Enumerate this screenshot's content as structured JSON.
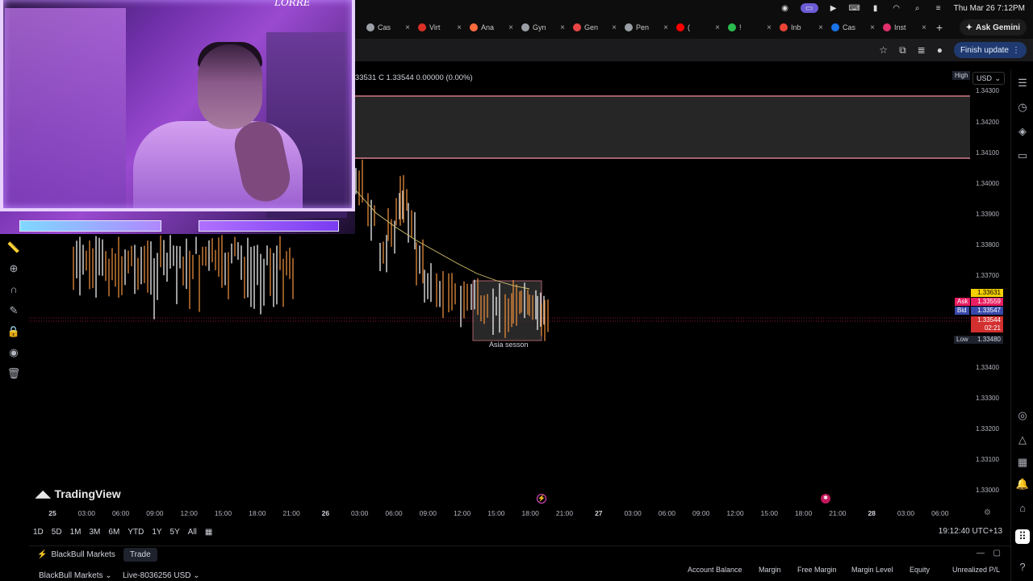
{
  "menubar": {
    "datetime": "Thu Mar 26  7:12PM",
    "icons": [
      "record-icon",
      "screen-share-icon",
      "play-icon",
      "keyboard-icon",
      "battery-icon",
      "wifi-icon",
      "search-icon",
      "control-center-icon"
    ]
  },
  "browser": {
    "tabs": [
      {
        "label": "Cas",
        "color": "#9aa0a6"
      },
      {
        "label": "Virt",
        "color": "#d93025"
      },
      {
        "label": "Ana",
        "color": "#ff6b3d"
      },
      {
        "label": "Gyn",
        "color": "#9aa0a6"
      },
      {
        "label": "Gen",
        "color": "#e84545"
      },
      {
        "label": "Pen",
        "color": "#9aa0a6"
      },
      {
        "label": "(",
        "color": "#ff0000"
      },
      {
        "label": "!",
        "color": "#2bbd4f"
      },
      {
        "label": "Inb",
        "color": "#ea4335"
      },
      {
        "label": "Cas",
        "color": "#1a73e8"
      },
      {
        "label": "Inst",
        "color": "#e1306c"
      }
    ],
    "ask_gemini": "Ask Gemini",
    "finish_update": "Finish update"
  },
  "chart": {
    "ohlc": "1.33531  C 1.33544  0.00000 (0.00%)",
    "currency": "USD",
    "high_label": "High",
    "low_label": "Low",
    "low_value": "1.33480",
    "price_ticks": [
      "1.34300",
      "1.34200",
      "1.34100",
      "1.34000",
      "1.33900",
      "1.33800",
      "1.33700",
      "1.33400",
      "1.33300",
      "1.33200",
      "1.33100",
      "1.33000"
    ],
    "price_badges": {
      "current": "1.33631",
      "ask_label": "Ask",
      "ask": "1.33559",
      "bid_label": "Bid",
      "bid": "1.33547",
      "last": "1.33544",
      "countdown": "02:21"
    },
    "time_labels": [
      "25",
      "03:00",
      "06:00",
      "09:00",
      "12:00",
      "15:00",
      "18:00",
      "21:00",
      "26",
      "03:00",
      "06:00",
      "09:00",
      "12:00",
      "15:00",
      "18:00",
      "21:00",
      "27",
      "03:00",
      "06:00",
      "09:00",
      "12:00",
      "15:00",
      "18:00",
      "21:00",
      "28",
      "03:00",
      "06:00"
    ],
    "session_label": "Asia sesson",
    "watermark": "TradingView"
  },
  "range_bar": {
    "ranges": [
      "1D",
      "5D",
      "1M",
      "3M",
      "6M",
      "YTD",
      "1Y",
      "5Y",
      "All"
    ],
    "utc_time": "19:12:40 UTC+13"
  },
  "bottom": {
    "broker": "BlackBull Markets",
    "trade": "Trade",
    "broker_account": "BlackBull Markets",
    "account_id": "Live-8036256 USD",
    "columns": [
      "Account Balance",
      "Margin",
      "Free Margin",
      "Margin Level",
      "Equity",
      "Unrealized P/L"
    ]
  },
  "webcam": {
    "overlay_text": "LORRE"
  }
}
